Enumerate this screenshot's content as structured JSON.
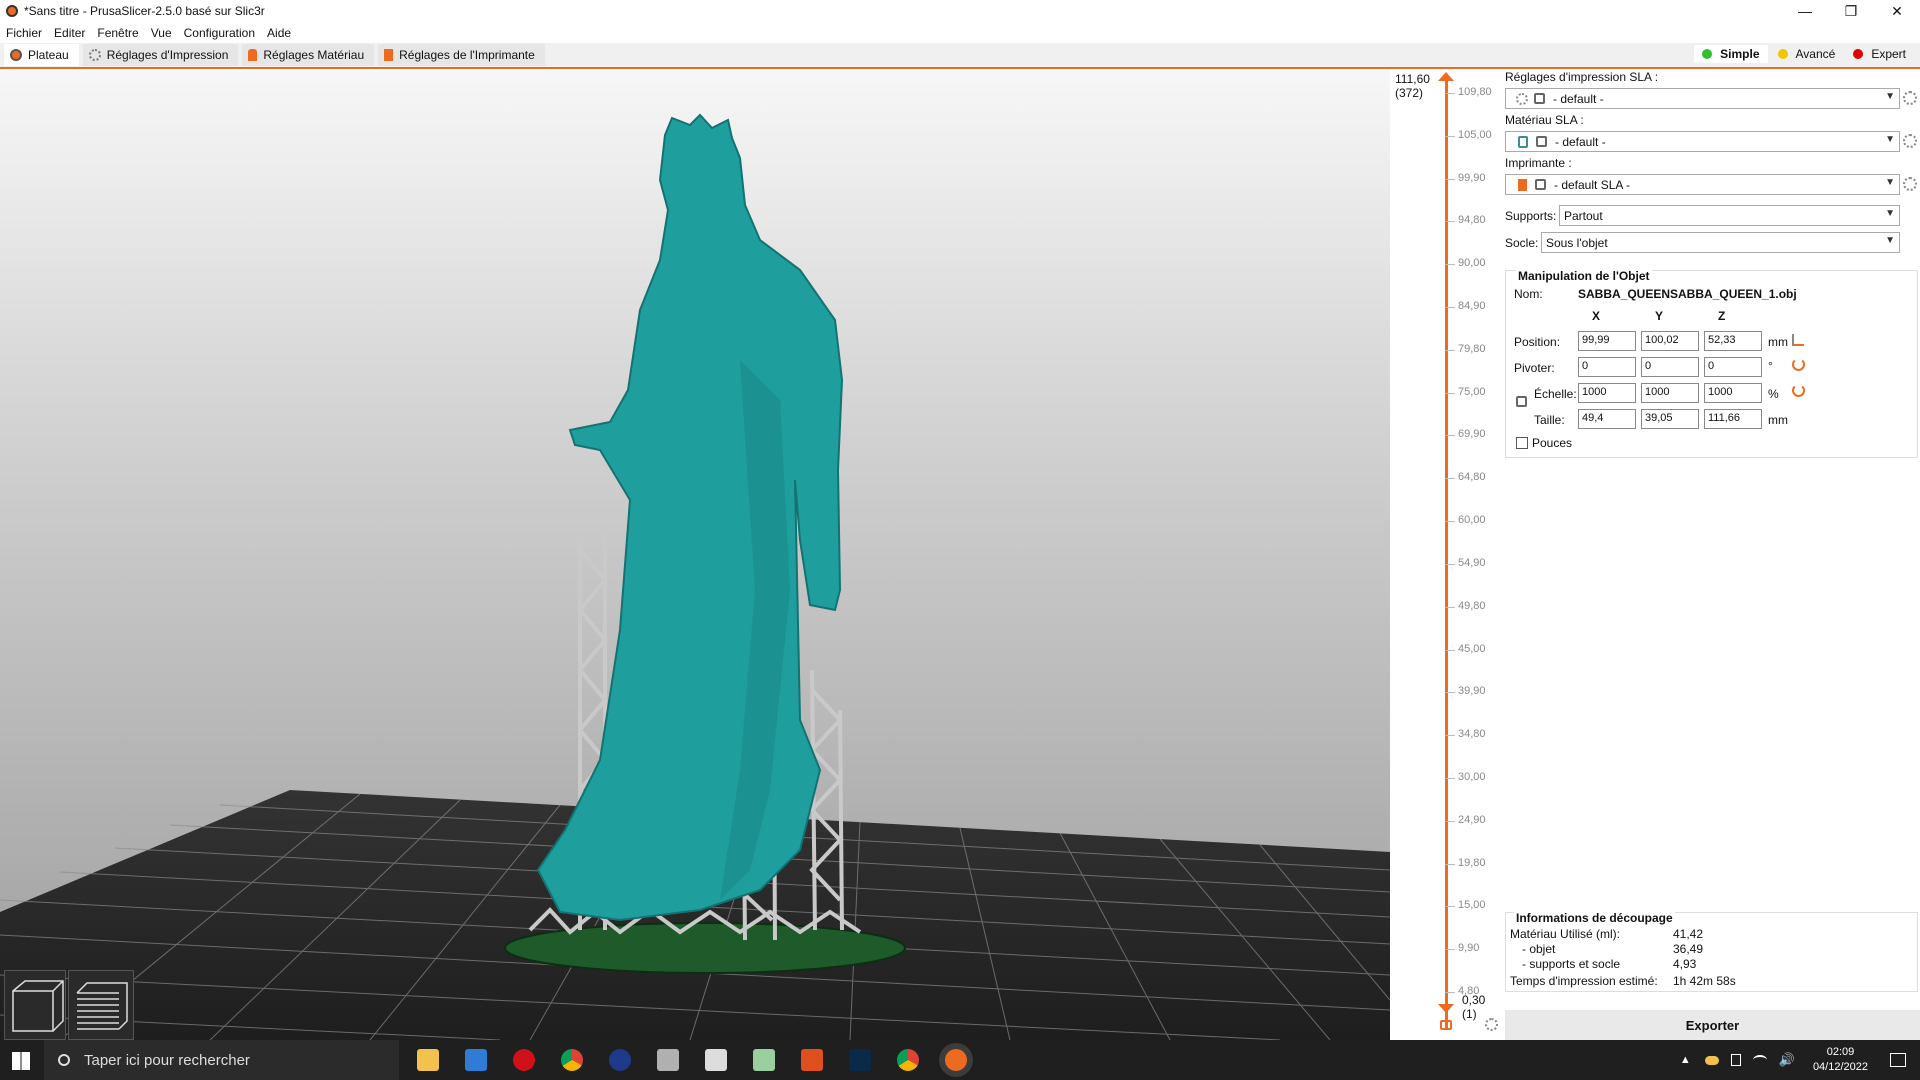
{
  "window": {
    "title": "*Sans titre - PrusaSlicer-2.5.0 basé sur Slic3r",
    "min": "—",
    "max": "❐",
    "close": "✕"
  },
  "menu": [
    "Fichier",
    "Editer",
    "Fenêtre",
    "Vue",
    "Configuration",
    "Aide"
  ],
  "tabs": [
    {
      "label": "Plateau",
      "active": true
    },
    {
      "label": "Réglages d'Impression",
      "active": false
    },
    {
      "label": "Réglages Matériau",
      "active": false
    },
    {
      "label": "Réglages de l'Imprimante",
      "active": false
    }
  ],
  "modes": [
    {
      "label": "Simple",
      "color": "#2fc02f",
      "active": true
    },
    {
      "label": "Avancé",
      "color": "#f0c800",
      "active": false
    },
    {
      "label": "Expert",
      "color": "#e00000",
      "active": false
    }
  ],
  "layer_slider": {
    "top_value": "111,60",
    "top_layer": "(372)",
    "bottom_value": "0,30",
    "bottom_layer": "(1)",
    "ticks": [
      "109,80",
      "105,00",
      "99,90",
      "94,80",
      "90,00",
      "84,90",
      "79,80",
      "75,00",
      "69,90",
      "64,80",
      "60,00",
      "54,90",
      "49,80",
      "45,00",
      "39,90",
      "34,80",
      "30,00",
      "24,90",
      "19,80",
      "15,00",
      "9,90",
      "4,80"
    ]
  },
  "sidebar": {
    "print_settings_label": "Réglages d'impression SLA :",
    "print_settings_value": "- default -",
    "material_label": "Matériau SLA :",
    "material_value": "- default -",
    "printer_label": "Imprimante :",
    "printer_value": "- default SLA -",
    "supports_label": "Supports:",
    "supports_value": "Partout",
    "pad_label": "Socle:",
    "pad_value": "Sous l'objet"
  },
  "object": {
    "heading": "Manipulation de l'Objet",
    "name_label": "Nom:",
    "name_value": "SABBA_QUEENSABBA_QUEEN_1.obj",
    "axis": [
      "X",
      "Y",
      "Z"
    ],
    "position_label": "Position:",
    "position": [
      "99,99",
      "100,02",
      "52,33"
    ],
    "position_unit": "mm",
    "rotate_label": "Pivoter:",
    "rotate": [
      "0",
      "0",
      "0"
    ],
    "rotate_unit": "°",
    "scale_label": "Échelle:",
    "scale": [
      "1000",
      "1000",
      "1000"
    ],
    "scale_unit": "%",
    "size_label": "Taille:",
    "size": [
      "49,4",
      "39,05",
      "111,66"
    ],
    "size_unit": "mm",
    "inches_label": "Pouces"
  },
  "slice_info": {
    "heading": "Informations de découpage",
    "material_label": "Matériau Utilisé (ml):",
    "material_value": "41,42",
    "object_label": "- objet",
    "object_value": "36,49",
    "support_label": "- supports et socle",
    "support_value": "4,93",
    "time_label": "Temps d'impression estimé:",
    "time_value": "1h 42m 58s"
  },
  "export_label": "Exporter",
  "taskbar": {
    "search_placeholder": "Taper ici pour rechercher",
    "time": "02:09",
    "date": "04/12/2022"
  }
}
